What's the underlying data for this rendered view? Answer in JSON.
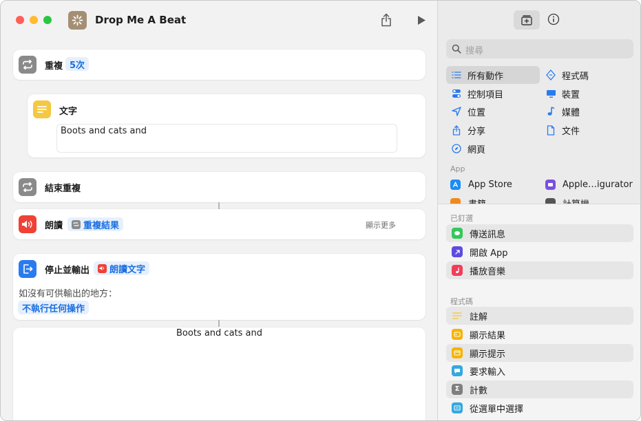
{
  "window": {
    "title": "Drop Me A Beat"
  },
  "editor": {
    "repeat": {
      "label": "重複",
      "count": "5次"
    },
    "text": {
      "label": "文字",
      "content": "Boots and cats and"
    },
    "end_repeat": {
      "label": "結束重複"
    },
    "speak": {
      "label": "朗讀",
      "token": "重複結果",
      "show_more": "顯示更多"
    },
    "stop": {
      "label": "停止並輸出",
      "token": "朗讀文字",
      "if_none": "如沒有可供輸出的地方：",
      "option": "不執行任何操作"
    },
    "output": {
      "text": "Boots and cats and"
    }
  },
  "sidebar": {
    "search_placeholder": "搜尋",
    "categories": [
      {
        "label": "所有動作",
        "icon": "list-icon"
      },
      {
        "label": "程式碼",
        "icon": "code-icon"
      },
      {
        "label": "控制項目",
        "icon": "toggle-icon"
      },
      {
        "label": "裝置",
        "icon": "display-icon"
      },
      {
        "label": "位置",
        "icon": "location-arrow-icon"
      },
      {
        "label": "媒體",
        "icon": "music-note-icon"
      },
      {
        "label": "分享",
        "icon": "share-icon"
      },
      {
        "label": "文件",
        "icon": "document-icon"
      },
      {
        "label": "網頁",
        "icon": "compass-icon"
      }
    ],
    "app_section": "App",
    "apps": [
      {
        "label": "App Store",
        "icon": "app-store-icon",
        "color": "#1a8cf5"
      },
      {
        "label": "Apple…igurator",
        "icon": "apple-configurator-icon",
        "color": "#7a4ee0"
      },
      {
        "label": "書籍",
        "icon": "books-icon",
        "color": "#f08a1d"
      },
      {
        "label": "計算機",
        "icon": "calculator-icon",
        "color": "#555555"
      }
    ],
    "pinned_section": "已釘選",
    "pinned": [
      {
        "label": "傳送訊息",
        "icon": "messages-icon",
        "color": "#34c759"
      },
      {
        "label": "開啟 App",
        "icon": "open-app-icon",
        "color": "#5e4be0"
      },
      {
        "label": "播放音樂",
        "icon": "music-icon",
        "color": "#f23d59"
      }
    ],
    "script_section": "程式碼",
    "scripting": [
      {
        "label": "註解",
        "icon": "comment-icon",
        "color": "#f7c948"
      },
      {
        "label": "顯示結果",
        "icon": "show-result-icon",
        "color": "#f5b400"
      },
      {
        "label": "顯示提示",
        "icon": "show-alert-icon",
        "color": "#f5b400"
      },
      {
        "label": "要求輸入",
        "icon": "ask-input-icon",
        "color": "#36a8e0"
      },
      {
        "label": "計數",
        "icon": "count-icon",
        "color": "#7f7f7f"
      },
      {
        "label": "從選單中選擇",
        "icon": "choose-menu-icon",
        "color": "#36a8e0"
      }
    ]
  }
}
